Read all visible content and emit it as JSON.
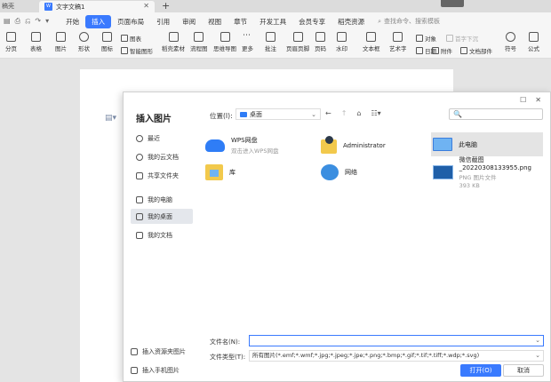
{
  "tabs": {
    "inactive_label": "稿壳",
    "active_label": "文字文稿1",
    "close_glyph": "✕",
    "add_glyph": "+"
  },
  "menubar": {
    "quick_access": [
      "▤",
      "⎙",
      "⎌",
      "↷",
      "▾"
    ],
    "items": [
      {
        "label": "开始",
        "active": false
      },
      {
        "label": "插入",
        "active": true
      },
      {
        "label": "页面布局",
        "active": false
      },
      {
        "label": "引用",
        "active": false
      },
      {
        "label": "审阅",
        "active": false
      },
      {
        "label": "视图",
        "active": false
      },
      {
        "label": "章节",
        "active": false
      },
      {
        "label": "开发工具",
        "active": false
      },
      {
        "label": "会员专享",
        "active": false
      },
      {
        "label": "稻壳资源",
        "active": false
      }
    ],
    "search_placeholder": "查找命令、搜索模板"
  },
  "ribbon": {
    "big": [
      "分页",
      "表格",
      "图片",
      "形状",
      "图标",
      "稻壳素材",
      "流程图",
      "思维导图",
      "更多",
      "批注",
      "页眉页脚",
      "页码",
      "水印",
      "文本框",
      "艺术字",
      "符号",
      "公式"
    ],
    "small": {
      "chart": "图表",
      "smart": "智能图形",
      "object": "对象",
      "date": "日期",
      "attach": "附件",
      "first_char": "首字下沉",
      "doc_part": "文档部件"
    }
  },
  "dialog": {
    "title": "插入图片",
    "location_label": "位置(I):",
    "location_value": "桌面",
    "search_glyph": "🔍",
    "sidebar": [
      {
        "label": "最近",
        "active": false
      },
      {
        "label": "我的云文档",
        "active": false
      },
      {
        "label": "共享文件夹",
        "active": false
      },
      {
        "label": "我的电脑",
        "active": false
      },
      {
        "label": "我的桌面",
        "active": true
      },
      {
        "label": "我的文档",
        "active": false
      }
    ],
    "items": [
      {
        "name": "WPS网盘",
        "sub": "双击进入WPS网盘"
      },
      {
        "name": "Administrator",
        "sub": ""
      },
      {
        "name": "此电脑",
        "sub": ""
      },
      {
        "name": "库",
        "sub": ""
      },
      {
        "name": "网络",
        "sub": ""
      },
      {
        "name": "微信截图_20220308133955.png",
        "sub": "PNG 图片文件",
        "size": "393 KB"
      }
    ],
    "bottom_links": [
      "插入资源夹图片",
      "插入手机图片"
    ],
    "filename_label": "文件名(N):",
    "filename_value": "",
    "filetype_label": "文件类型(T):",
    "filetype_value": "所有图片(*.emf;*.wmf;*.jpg;*.jpeg;*.jpe;*.png;*.bmp;*.gif;*.tif;*.tiff;*.wdp;*.svg)",
    "open_label": "打开(O)",
    "cancel_label": "取消"
  }
}
